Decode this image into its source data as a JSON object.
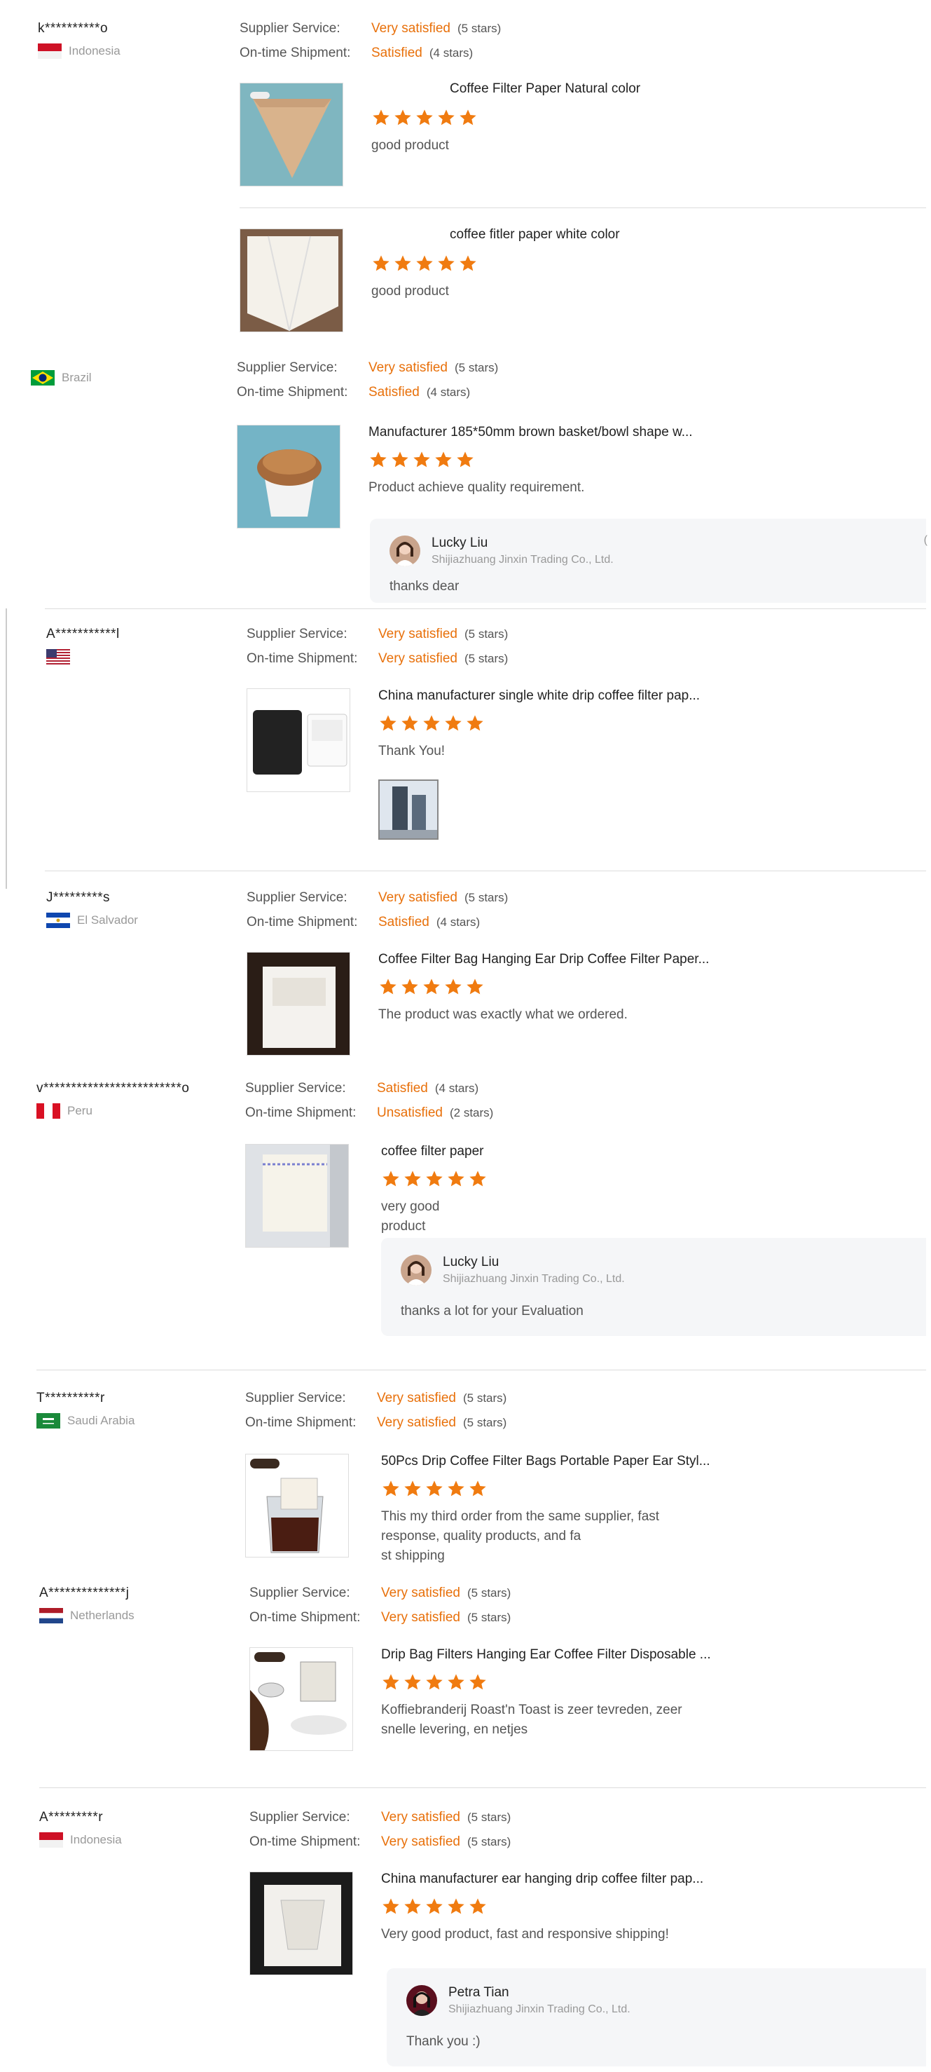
{
  "labels": {
    "supplier_service": "Supplier Service:",
    "ontime_shipment": "On-time Shipment:"
  },
  "star_color": "#f07b10",
  "accent_color": "#e8700a",
  "reviews": [
    {
      "user": "k**********o",
      "country": "Indonesia",
      "flag": "indonesia",
      "supplier_service": "Very satisfied",
      "supplier_stars": "(5 stars)",
      "shipment": "Satisfied",
      "shipment_stars": "(4 stars)",
      "products": [
        {
          "title": "Coffee Filter Paper Natural color",
          "rating": 5,
          "comment": "good product"
        },
        {
          "title": "coffee fitler paper white color",
          "rating": 5,
          "comment": "good product"
        }
      ]
    },
    {
      "user": "",
      "country": "Brazil",
      "flag": "brazil",
      "supplier_service": "Very satisfied",
      "supplier_stars": "(5 stars)",
      "shipment": "Satisfied",
      "shipment_stars": "(4 stars)",
      "products": [
        {
          "title": "Manufacturer 185*50mm brown basket/bowl shape w...",
          "rating": 5,
          "comment": "Product achieve quality requirement."
        }
      ],
      "reply": {
        "name": "Lucky Liu",
        "company": "Shijiazhuang Jinxin Trading Co., Ltd.",
        "text": "thanks dear",
        "date": "("
      }
    },
    {
      "user": "A***********l",
      "country": "",
      "flag": "usa",
      "supplier_service": "Very satisfied",
      "supplier_stars": "(5 stars)",
      "shipment": "Very satisfied",
      "shipment_stars": "(5 stars)",
      "products": [
        {
          "title": "China manufacturer single white drip coffee filter pap...",
          "rating": 5,
          "comment": "Thank You!"
        }
      ]
    },
    {
      "user": "J*********s",
      "country": "El Salvador",
      "flag": "elsalvador",
      "supplier_service": "Very satisfied",
      "supplier_stars": "(5 stars)",
      "shipment": "Satisfied",
      "shipment_stars": "(4 stars)",
      "products": [
        {
          "title": "Coffee Filter Bag Hanging Ear Drip Coffee Filter Paper...",
          "rating": 5,
          "comment": "The product was exactly what we ordered."
        }
      ]
    },
    {
      "user": "v*************************o",
      "country": "Peru",
      "flag": "peru",
      "supplier_service": "Satisfied",
      "supplier_stars": "(4 stars)",
      "shipment": "Unsatisfied",
      "shipment_stars": "(2 stars)",
      "products": [
        {
          "title": "coffee filter paper",
          "rating": 5,
          "comment": "very good product"
        }
      ],
      "reply": {
        "name": "Lucky Liu",
        "company": "Shijiazhuang Jinxin Trading Co., Ltd.",
        "text": "thanks a lot for your Evaluation"
      }
    },
    {
      "user": "T**********r",
      "country": "Saudi Arabia",
      "flag": "saudi",
      "supplier_service": "Very satisfied",
      "supplier_stars": "(5 stars)",
      "shipment": "Very satisfied",
      "shipment_stars": "(5 stars)",
      "products": [
        {
          "title": "50Pcs Drip Coffee Filter Bags Portable Paper Ear Styl...",
          "rating": 5,
          "comment": "This my third order from the same supplier, fast response, quality products, and fa",
          "comment2": "st shipping"
        }
      ]
    },
    {
      "user": "A**************j",
      "country": "Netherlands",
      "flag": "netherlands",
      "supplier_service": "Very satisfied",
      "supplier_stars": "(5 stars)",
      "shipment": "Very satisfied",
      "shipment_stars": "(5 stars)",
      "products": [
        {
          "title": "Drip Bag Filters Hanging Ear Coffee Filter Disposable ...",
          "rating": 5,
          "comment": "Koffiebranderij Roast'n Toast is zeer tevreden, zeer snelle levering, en netjes"
        }
      ]
    },
    {
      "user": "A*********r",
      "country": "Indonesia",
      "flag": "indonesia",
      "supplier_service": "Very satisfied",
      "supplier_stars": "(5 stars)",
      "shipment": "Very satisfied",
      "shipment_stars": "(5 stars)",
      "products": [
        {
          "title": "China manufacturer ear hanging drip coffee filter pap...",
          "rating": 5,
          "comment": "Very good product, fast and responsive shipping!"
        }
      ],
      "reply": {
        "name": "Petra Tian",
        "company": "Shijiazhuang Jinxin Trading Co., Ltd.",
        "text": "Thank you :)"
      }
    }
  ]
}
